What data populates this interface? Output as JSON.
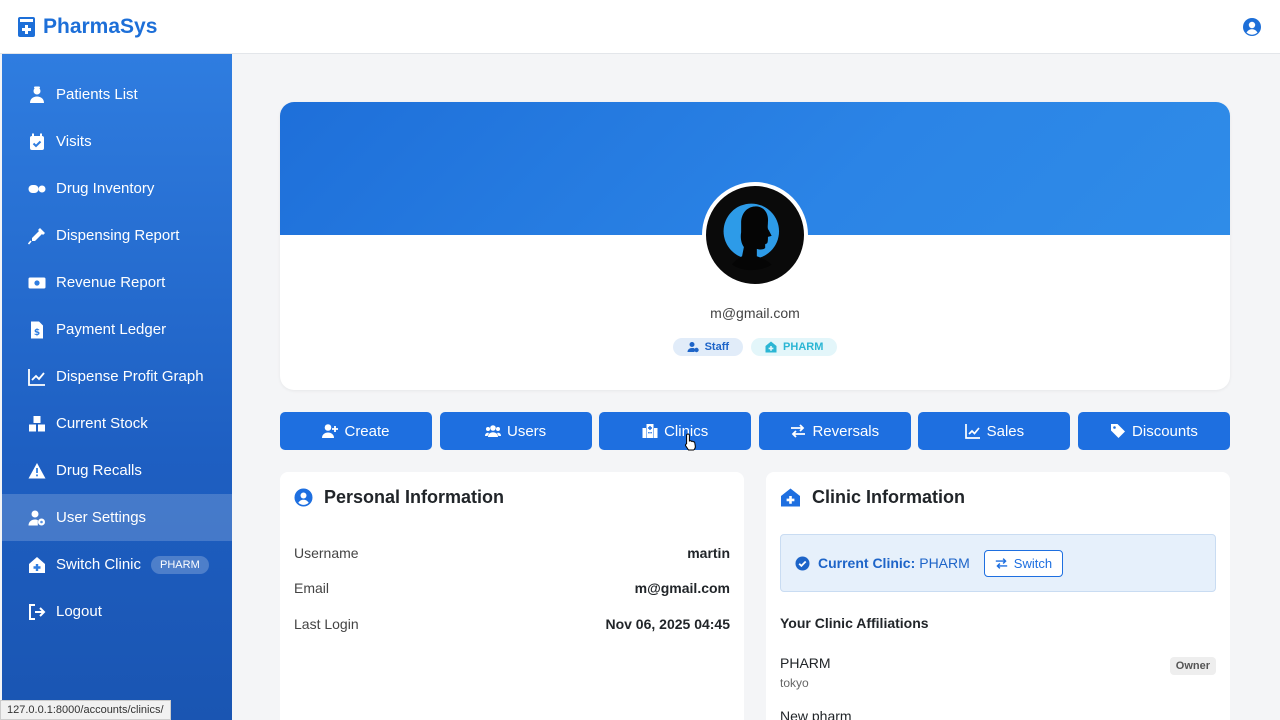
{
  "app": {
    "brand": "PharmaSys"
  },
  "sidebar": {
    "items": [
      {
        "label": "Patients List",
        "icon": "user-nurse-icon"
      },
      {
        "label": "Visits",
        "icon": "calendar-check-icon"
      },
      {
        "label": "Drug Inventory",
        "icon": "pills-icon"
      },
      {
        "label": "Dispensing Report",
        "icon": "syringe-icon"
      },
      {
        "label": "Revenue Report",
        "icon": "money-bill-icon"
      },
      {
        "label": "Payment Ledger",
        "icon": "file-invoice-dollar-icon"
      },
      {
        "label": "Dispense Profit Graph",
        "icon": "chart-line-icon"
      },
      {
        "label": "Current Stock",
        "icon": "cubes-icon"
      },
      {
        "label": "Drug Recalls",
        "icon": "warning-icon"
      },
      {
        "label": "User Settings",
        "icon": "user-cog-icon",
        "active": true
      },
      {
        "label": "Switch Clinic",
        "icon": "clinic-medical-icon",
        "badge": "PHARM"
      },
      {
        "label": "Logout",
        "icon": "sign-out-icon"
      }
    ]
  },
  "status_bar": {
    "url": "127.0.0.1:8000/accounts/clinics/"
  },
  "profile": {
    "email": "m@gmail.com",
    "badges": [
      {
        "label": "Staff"
      },
      {
        "label": "PHARM"
      }
    ]
  },
  "actions": [
    {
      "label": "Create"
    },
    {
      "label": "Users"
    },
    {
      "label": "Clinics"
    },
    {
      "label": "Reversals"
    },
    {
      "label": "Sales"
    },
    {
      "label": "Discounts"
    }
  ],
  "personal": {
    "title": "Personal Information",
    "rows": [
      {
        "label": "Username",
        "value": "martin"
      },
      {
        "label": "Email",
        "value": "m@gmail.com"
      },
      {
        "label": "Last Login",
        "value": "Nov 06, 2025 04:45"
      }
    ]
  },
  "clinic": {
    "title": "Clinic Information",
    "current_label": "Current Clinic:",
    "current_value": "PHARM",
    "switch_label": "Switch",
    "affiliations_title": "Your Clinic Affiliations",
    "affiliations": [
      {
        "name": "PHARM",
        "location": "tokyo",
        "role": "Owner"
      },
      {
        "name": "New pharm",
        "location": "",
        "role": ""
      }
    ]
  },
  "colors": {
    "primary": "#1e6fe0",
    "sidebar": "#2f7de0",
    "staff_badge": "#1d64c8",
    "pharm_badge": "#2bb6d4"
  }
}
